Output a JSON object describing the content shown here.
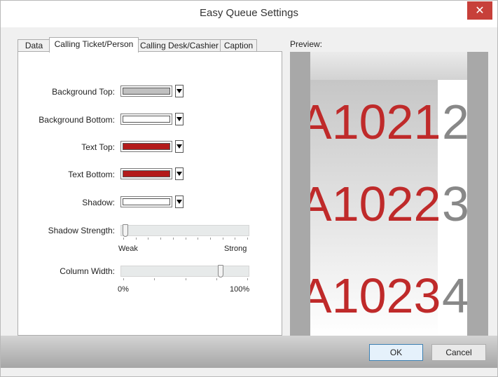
{
  "window": {
    "title": "Easy Queue Settings",
    "close_icon": "close-icon"
  },
  "tabs": [
    {
      "label": "Data",
      "active": false
    },
    {
      "label": "Calling Ticket/Person",
      "active": true
    },
    {
      "label": "Calling Desk/Cashier",
      "active": false
    },
    {
      "label": "Caption",
      "active": false
    }
  ],
  "settings": {
    "background_top": {
      "label": "Background Top:",
      "color": "#c0c0c0"
    },
    "background_bottom": {
      "label": "Background Bottom:",
      "color": "#ffffff"
    },
    "text_top": {
      "label": "Text Top:",
      "color": "#b31b1b"
    },
    "text_bottom": {
      "label": "Text Bottom:",
      "color": "#b31b1b"
    },
    "shadow": {
      "label": "Shadow:",
      "color": "#ffffff"
    },
    "shadow_strength": {
      "label": "Shadow Strength:",
      "min_label": "Weak",
      "max_label": "Strong",
      "value": 0.0
    },
    "column_width": {
      "label": "Column Width:",
      "min_label": "0%",
      "max_label": "100%",
      "value": 0.8
    }
  },
  "preview": {
    "label": "Preview:",
    "rows": [
      {
        "red": "A1021",
        "grey": "2"
      },
      {
        "red": "A1022",
        "grey": "3"
      },
      {
        "red": "A1023",
        "grey": "4"
      }
    ],
    "colors": {
      "red": "#bf2a2a",
      "grey": "#888888"
    }
  },
  "buttons": {
    "ok": "OK",
    "cancel": "Cancel"
  }
}
